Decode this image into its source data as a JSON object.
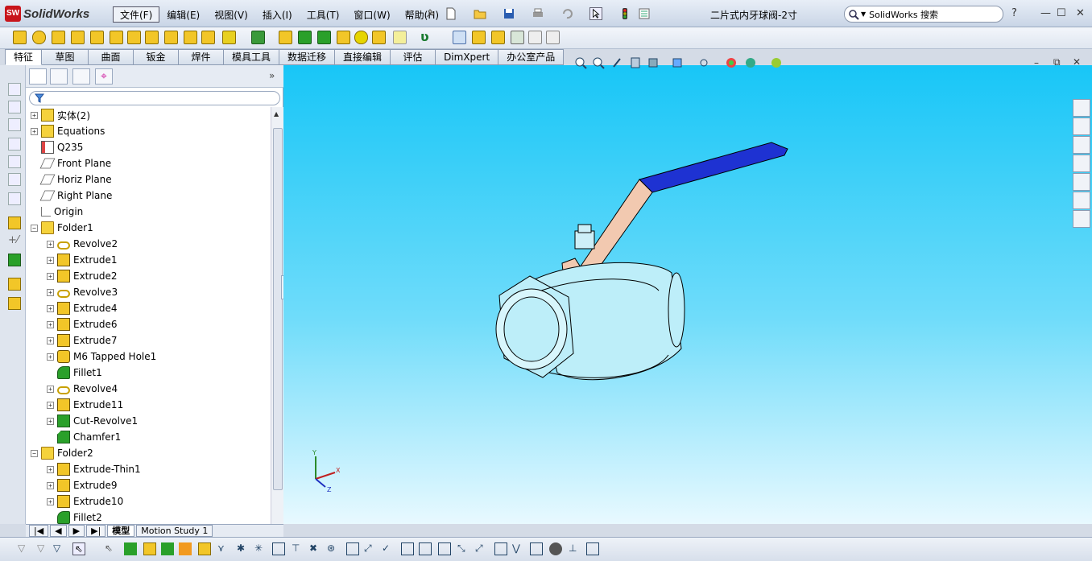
{
  "app": {
    "logo_badge": "SW",
    "name": "SolidWorks"
  },
  "menu": [
    {
      "label": "文件(F)",
      "active": true
    },
    {
      "label": "编辑(E)"
    },
    {
      "label": "视图(V)"
    },
    {
      "label": "插入(I)"
    },
    {
      "label": "工具(T)"
    },
    {
      "label": "窗口(W)"
    },
    {
      "label": "帮助(H)"
    }
  ],
  "window": {
    "title": "二片式内牙球阀-2寸"
  },
  "search": {
    "value": "SolidWorks 搜索"
  },
  "window_controls": {
    "help": "?",
    "minimize": "—",
    "restore": "☐",
    "close": "✕"
  },
  "command_tabs": [
    "特征",
    "草图",
    "曲面",
    "钣金",
    "焊件",
    "模具工具",
    "数据迁移",
    "直接编辑",
    "评估",
    "DimXpert",
    "办公室产品"
  ],
  "feature_tree": [
    {
      "label": "实体(2)",
      "icon": "solid-bodies-folder-icon",
      "expand": "+",
      "level": 0
    },
    {
      "label": "Equations",
      "icon": "equations-icon",
      "expand": "+",
      "level": 0
    },
    {
      "label": "Q235",
      "icon": "material-icon",
      "expand": "",
      "level": 0
    },
    {
      "label": "Front Plane",
      "icon": "plane-icon",
      "expand": "",
      "level": 0
    },
    {
      "label": "Horiz Plane",
      "icon": "plane-icon",
      "expand": "",
      "level": 0
    },
    {
      "label": "Right Plane",
      "icon": "plane-icon",
      "expand": "",
      "level": 0
    },
    {
      "label": "Origin",
      "icon": "origin-icon",
      "expand": "",
      "level": 0
    },
    {
      "label": "Folder1",
      "icon": "folder-icon",
      "expand": "−",
      "level": 0
    },
    {
      "label": "Revolve2",
      "icon": "revolve-icon",
      "expand": "+",
      "level": 1
    },
    {
      "label": "Extrude1",
      "icon": "extrude-icon",
      "expand": "+",
      "level": 1
    },
    {
      "label": "Extrude2",
      "icon": "extrude-icon",
      "expand": "+",
      "level": 1
    },
    {
      "label": "Revolve3",
      "icon": "revolve-icon",
      "expand": "+",
      "level": 1
    },
    {
      "label": "Extrude4",
      "icon": "extrude-icon",
      "expand": "+",
      "level": 1
    },
    {
      "label": "Extrude6",
      "icon": "extrude-icon",
      "expand": "+",
      "level": 1
    },
    {
      "label": "Extrude7",
      "icon": "extrude-icon",
      "expand": "+",
      "level": 1
    },
    {
      "label": "M6 Tapped Hole1",
      "icon": "hole-wizard-icon",
      "expand": "+",
      "level": 1
    },
    {
      "label": "Fillet1",
      "icon": "fillet-icon",
      "expand": "",
      "level": 1
    },
    {
      "label": "Revolve4",
      "icon": "revolve-icon",
      "expand": "+",
      "level": 1
    },
    {
      "label": "Extrude11",
      "icon": "extrude-icon",
      "expand": "+",
      "level": 1
    },
    {
      "label": "Cut-Revolve1",
      "icon": "cut-revolve-icon",
      "expand": "+",
      "level": 1
    },
    {
      "label": "Chamfer1",
      "icon": "chamfer-icon",
      "expand": "",
      "level": 1
    },
    {
      "label": "Folder2",
      "icon": "folder-icon",
      "expand": "−",
      "level": 0
    },
    {
      "label": "Extrude-Thin1",
      "icon": "extrude-icon",
      "expand": "+",
      "level": 1
    },
    {
      "label": "Extrude9",
      "icon": "extrude-icon",
      "expand": "+",
      "level": 1
    },
    {
      "label": "Extrude10",
      "icon": "extrude-icon",
      "expand": "+",
      "level": 1
    },
    {
      "label": "Fillet2",
      "icon": "fillet-icon",
      "expand": "",
      "level": 1
    }
  ],
  "bottom_tabs": [
    "模型",
    "Motion Study 1"
  ],
  "triad": {
    "x": "X",
    "y": "Y",
    "z": "Z"
  },
  "colors": {
    "viewport_top": "#18c6f7",
    "viewport_bottom": "#e8f9ff",
    "handle_grip": "#1e32d2",
    "lever": "#f2c9b0",
    "valve_body": "#bdeef9"
  }
}
